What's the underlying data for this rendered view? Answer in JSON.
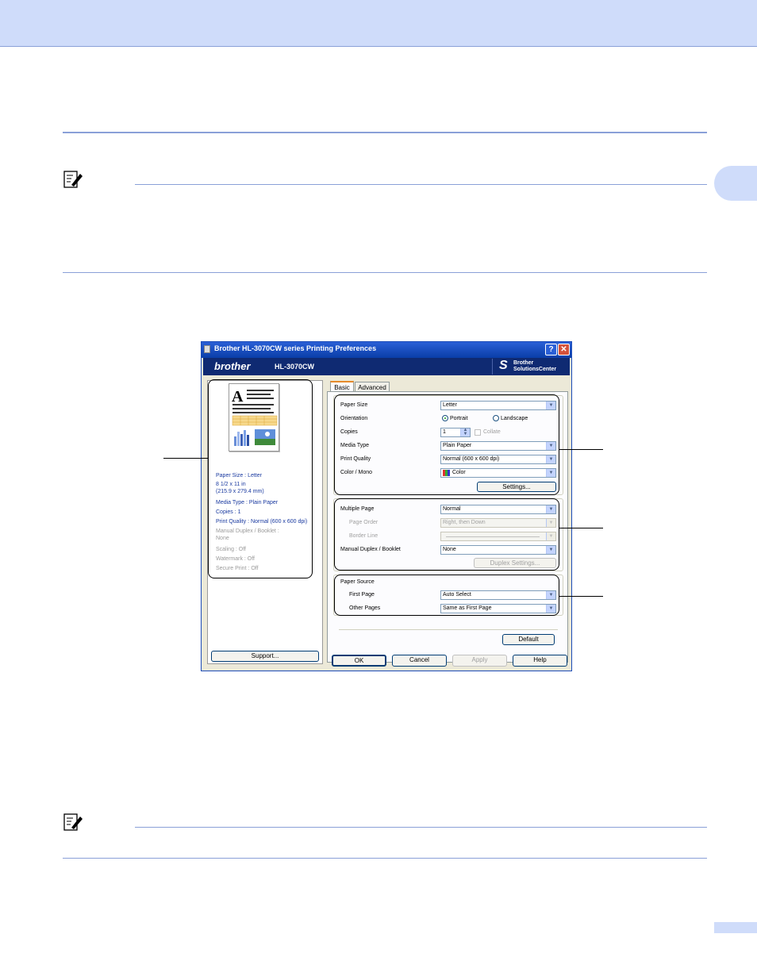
{
  "dialog": {
    "title": "Brother HL-3070CW series Printing Preferences",
    "help_button": "?",
    "close_button": "✕",
    "brand": {
      "logo": "brother",
      "model": "HL-3070CW",
      "solutions_line1": "Brother",
      "solutions_line2": "SolutionsCenter"
    },
    "summary": {
      "paper_size": "Paper Size : Letter",
      "dim1": "8 1/2 x 11 in",
      "dim2": "(215.9 x 279.4 mm)",
      "media": "Media Type : Plain Paper",
      "copies": "Copies : 1",
      "quality": "Print Quality : Normal (600 x 600 dpi)",
      "duplex": "Manual Duplex / Booklet :",
      "duplex_val": "None",
      "scaling": "Scaling : Off",
      "watermark": "Watermark : Off",
      "secure": "Secure Print : Off"
    },
    "support_button": "Support...",
    "tabs": [
      "Basic",
      "Advanced"
    ],
    "basic": {
      "paper_size_label": "Paper Size",
      "paper_size_value": "Letter",
      "orientation_label": "Orientation",
      "portrait": "Portrait",
      "landscape": "Landscape",
      "copies_label": "Copies",
      "copies_value": "1",
      "collate": "Collate",
      "media_type_label": "Media Type",
      "media_type_value": "Plain Paper",
      "print_quality_label": "Print Quality",
      "print_quality_value": "Normal (600 x 600 dpi)",
      "color_mono_label": "Color / Mono",
      "color_mono_value": "Color",
      "settings_button": "Settings...",
      "multiple_page_label": "Multiple Page",
      "multiple_page_value": "Normal",
      "page_order_label": "Page Order",
      "page_order_value": "Right, then Down",
      "border_line_label": "Border Line",
      "manual_duplex_label": "Manual Duplex / Booklet",
      "manual_duplex_value": "None",
      "duplex_settings_button": "Duplex Settings...",
      "paper_source_label": "Paper Source",
      "first_page_label": "First Page",
      "first_page_value": "Auto Select",
      "other_pages_label": "Other Pages",
      "other_pages_value": "Same as First Page",
      "default_button": "Default"
    },
    "buttons": {
      "ok": "OK",
      "cancel": "Cancel",
      "apply": "Apply",
      "help": "Help"
    }
  },
  "colors": {
    "top_band": "#cfdcfa",
    "rule": "#8aa0d8",
    "title_bar": "#0a3ea8",
    "brand_bar": "#0f2a72"
  },
  "icons": [
    "note-pencil-icon",
    "printer-icon",
    "help-icon",
    "close-icon",
    "dropdown-arrow-icon",
    "color-swatch-icon",
    "spinner-icon"
  ]
}
